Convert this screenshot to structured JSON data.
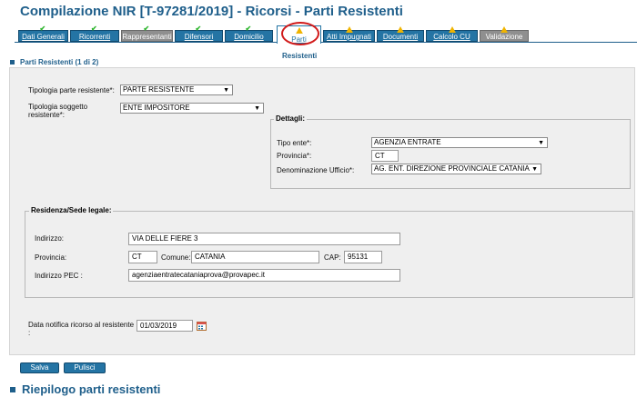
{
  "header": {
    "title": "Compilazione NIR [T-97281/2019] - Ricorsi - Parti Resistenti"
  },
  "tabs": [
    {
      "label": "Dati Generali",
      "status": "check"
    },
    {
      "label": "Ricorrenti",
      "status": "check"
    },
    {
      "label": "Rappresentanti",
      "status": "check"
    },
    {
      "label": "Difensori",
      "status": "check"
    },
    {
      "label": "Domicilio",
      "status": "check"
    },
    {
      "label": "Parti",
      "status": "warning",
      "subtitle": "Resistenti"
    },
    {
      "label": "Atti Impugnati",
      "status": "warning"
    },
    {
      "label": "Documenti",
      "status": "warning"
    },
    {
      "label": "Calcolo CU",
      "status": "warning"
    },
    {
      "label": "Validazione",
      "status": "warning"
    }
  ],
  "section": {
    "title": "Parti Resistenti (1 di 2)"
  },
  "form": {
    "tipologia_parte_label": "Tipologia parte resistente*:",
    "tipologia_parte_value": "PARTE RESISTENTE",
    "tipologia_soggetto_label_1": "Tipologia soggetto",
    "tipologia_soggetto_label_2": "resistente*:",
    "tipologia_soggetto_value": "ENTE IMPOSITORE",
    "dettagli": {
      "legend": "Dettagli:",
      "tipo_ente_label": "Tipo ente*:",
      "tipo_ente_value": "AGENZIA ENTRATE",
      "provincia_label": "Provincia*:",
      "provincia_value": "CT",
      "ufficio_label": "Denominazione Ufficio*:",
      "ufficio_value": "AG. ENT. DIREZIONE PROVINCIALE CATANIA"
    },
    "residenza": {
      "legend": "Residenza/Sede legale:",
      "indirizzo_label": "Indirizzo:",
      "indirizzo_value": "VIA DELLE FIERE 3",
      "provincia_label": "Provincia:",
      "provincia_value": "CT",
      "comune_label": "Comune:",
      "comune_value": "CATANIA",
      "cap_label": "CAP:",
      "cap_value": "95131",
      "pec_label": "Indirizzo PEC :",
      "pec_value": "agenziaentratecataniaprova@provapec.it"
    },
    "data_notifica_label": "Data notifica ricorso al resistente",
    "data_notifica_colon": ":",
    "data_notifica_value": "01/03/2019"
  },
  "buttons": {
    "salva": "Salva",
    "pulisci": "Pulisci"
  },
  "bottom": {
    "title": "Riepilogo parti resistenti"
  },
  "colors": {
    "accent": "#1f5f8b",
    "tab": "#2474a4",
    "check": "#2db52d",
    "warning": "#f0b400",
    "highlight": "#d11a1a"
  }
}
